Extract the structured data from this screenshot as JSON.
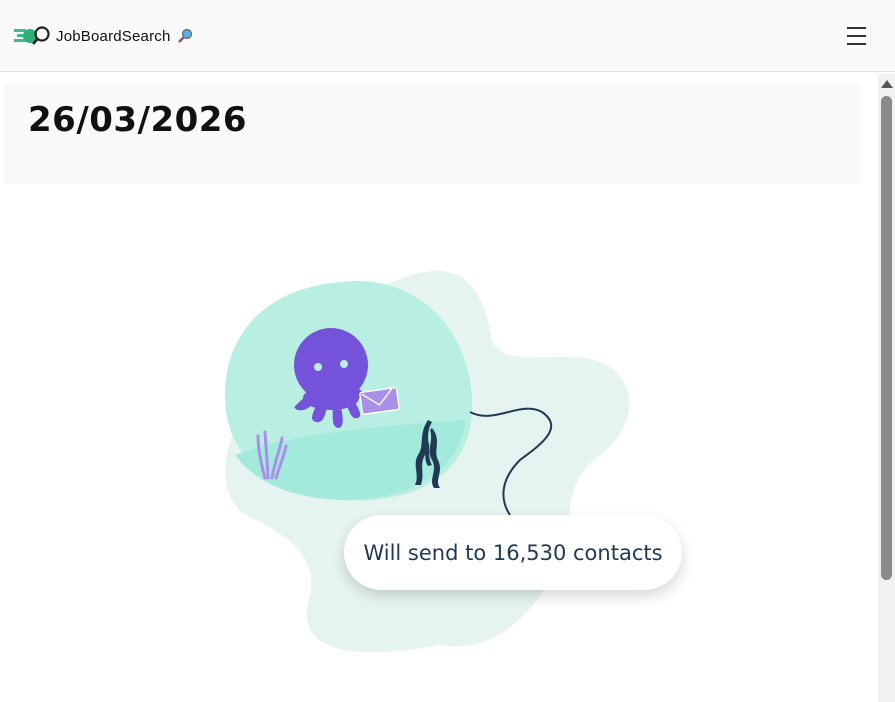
{
  "header": {
    "brand_name": "JobBoardSearch",
    "logo_icon": "binoculars-speed-logo",
    "glass_icon": "magnifying-glass-icon",
    "menu_icon": "hamburger-menu-icon"
  },
  "main": {
    "date_title": "26/03/2026",
    "illustration": "octopus-mail-illustration",
    "contacts_message": "Will send to 16,530 contacts"
  },
  "colors": {
    "blob_light": "#e6f4f1",
    "blob_teal": "#b9efe3",
    "water": "#a3eadc",
    "octopus": "#7452d9",
    "envelope": "#a88fe8",
    "text_dark": "#1f3a52"
  }
}
